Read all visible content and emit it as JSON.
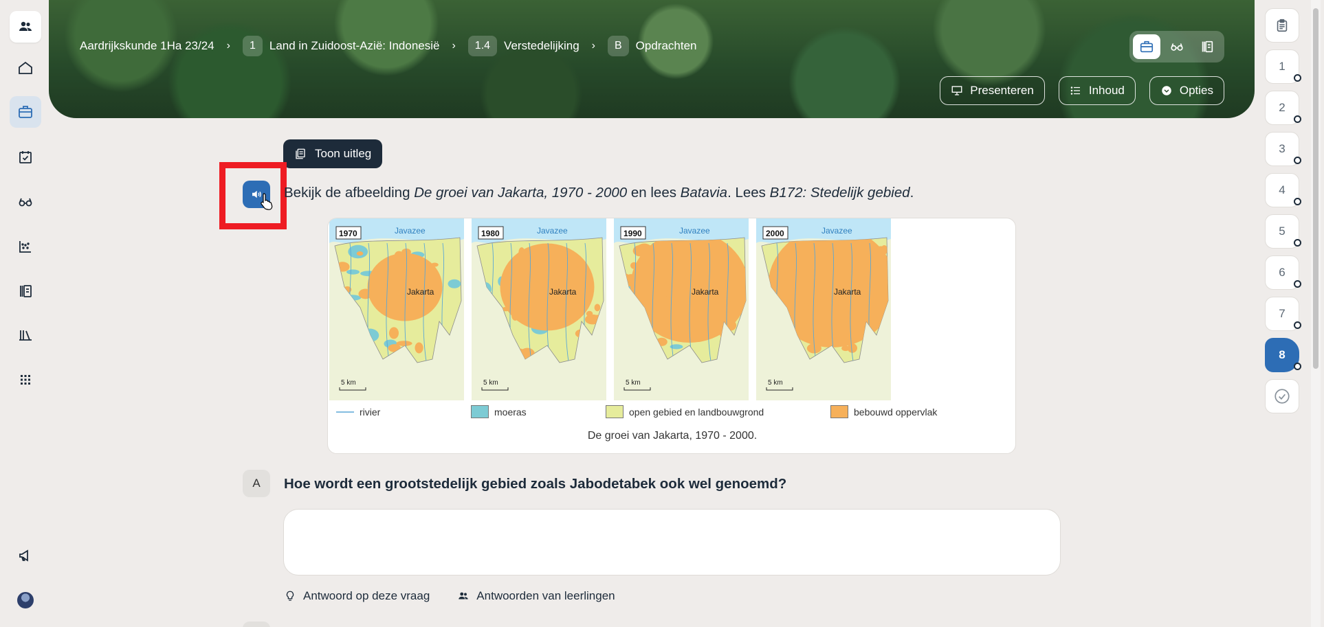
{
  "breadcrumb": {
    "course": "Aardrijkskunde 1Ha 23/24",
    "chapter_num": "1",
    "chapter": "Land in Zuidoost-Azië: Indonesië",
    "section_num": "1.4",
    "section": "Verstedelijking",
    "part_num": "B",
    "part": "Opdrachten",
    "separator": "›"
  },
  "banner_actions": {
    "present": "Presenteren",
    "contents": "Inhoud",
    "options": "Opties"
  },
  "sidebar": {
    "items": [
      "users-icon",
      "home-icon",
      "briefcase-icon",
      "calendar-check-icon",
      "glasses-icon",
      "scatter-chart-icon",
      "binder-icon",
      "library-icon",
      "apps-grid-icon",
      "megaphone-icon"
    ]
  },
  "rail": {
    "items": [
      "1",
      "2",
      "3",
      "4",
      "5",
      "6",
      "7",
      "8"
    ],
    "active": "8"
  },
  "content": {
    "toon_uitleg": "Toon uitleg",
    "instruction_pre": "Bekijk de afbeelding ",
    "instruction_title": "De groei van Jakarta, 1970 - 2000",
    "instruction_mid": " en lees ",
    "instruction_batavia": "Batavia",
    "instruction_mid2": ". Lees ",
    "instruction_ref": "B172: Stedelijk gebied",
    "instruction_end": "."
  },
  "figure": {
    "maps": [
      {
        "year": "1970",
        "sea": "Javazee",
        "city": "Jakarta",
        "scale": "5 km"
      },
      {
        "year": "1980",
        "sea": "Javazee",
        "city": "Jakarta",
        "scale": "5 km"
      },
      {
        "year": "1990",
        "sea": "Javazee",
        "city": "Jakarta",
        "scale": "5 km"
      },
      {
        "year": "2000",
        "sea": "Javazee",
        "city": "Jakarta",
        "scale": "5 km"
      }
    ],
    "legend": {
      "river": "rivier",
      "swamp": "moeras",
      "open": "open gebied en landbouwgrond",
      "built": "bebouwd oppervlak"
    },
    "caption": "De groei van Jakarta, 1970 - 2000.",
    "colors": {
      "sea": "#bfe6f7",
      "swamp": "#7dcbd4",
      "open": "#e6ec9c",
      "built": "#f6b05a",
      "river": "#5aa7d6",
      "background": "#eef2d9"
    }
  },
  "question": {
    "letter": "A",
    "text": "Hoe wordt een grootstedelijk gebied zoals Jabodetabek ook wel genoemd?"
  },
  "answer_links": {
    "answer": "Antwoord op deze vraag",
    "student_answers": "Antwoorden van leerlingen"
  },
  "accent_colors": {
    "primary": "#2d6db5",
    "dark": "#1d2b3a",
    "highlight": "#ee1c23"
  }
}
